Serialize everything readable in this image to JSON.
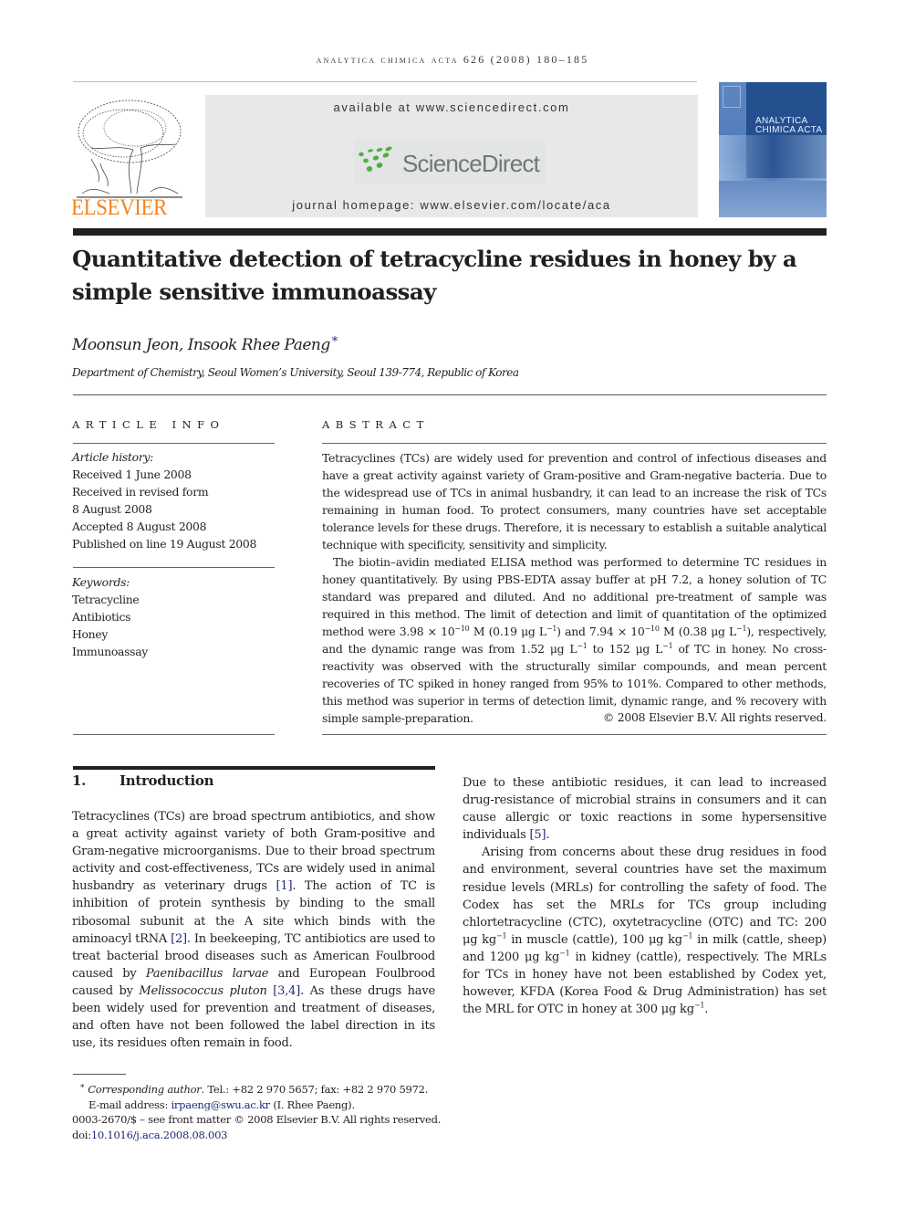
{
  "header": {
    "running_head": "analytica chimica acta 626 (2008) 180–185",
    "available_at": "available at www.sciencedirect.com",
    "sciencedirect_logo": "ScienceDirect",
    "journal_homepage": "journal homepage: www.elsevier.com/locate/aca",
    "publisher_logo": "ELSEVIER",
    "cover": {
      "line1": "ANALYTICA",
      "line2": "CHIMICA ACTA"
    },
    "colors": {
      "elsevier_orange": "#f5841f",
      "sciencedirect_green": "#4fae3a",
      "link_blue": "#1d2a7a",
      "cover_blue": "#1f4a8a"
    }
  },
  "article": {
    "title": "Quantitative detection of tetracycline residues in honey by a simple sensitive immunoassay",
    "authors": "Moonsun Jeon, Insook Rhee Paeng",
    "corresponding_marker": "*",
    "affiliation": "Department of Chemistry, Seoul Women’s University, Seoul 139-774, Republic of Korea"
  },
  "article_info": {
    "heading": "ARTICLE INFO",
    "history_label": "Article history:",
    "history": [
      "Received 1 June 2008",
      "Received in revised form",
      "8 August 2008",
      "Accepted 8 August 2008",
      "Published on line 19 August 2008"
    ],
    "keywords_label": "Keywords:",
    "keywords": [
      "Tetracycline",
      "Antibiotics",
      "Honey",
      "Immunoassay"
    ]
  },
  "abstract": {
    "heading": "ABSTRACT",
    "p1": "Tetracyclines (TCs) are widely used for prevention and control of infectious diseases and have a great activity against variety of Gram-positive and Gram-negative bacteria. Due to the widespread use of TCs in animal husbandry, it can lead to an increase the risk of TCs remaining in human food. To protect consumers, many countries have set acceptable tolerance levels for these drugs. Therefore, it is necessary to establish a suitable analytical technique with specificity, sensitivity and simplicity.",
    "p2_a": "The biotin–avidin mediated ELISA method was performed to determine TC residues in honey quantitatively. By using PBS-EDTA assay buffer at pH 7.2, a honey solution of TC standard was prepared and diluted. And no additional pre-treatment of sample was required in this method. The limit of detection and limit of quantitation of the optimized method were 3.98 × 10",
    "p2_exp1": "−10",
    "p2_b": " M (0.19 μg L",
    "p2_exp2": "−1",
    "p2_c": ") and 7.94 × 10",
    "p2_exp3": "−10",
    "p2_d": " M (0.38 μg L",
    "p2_exp4": "−1",
    "p2_e": "), respectively, and the dynamic range was from 1.52 μg L",
    "p2_exp5": "−1",
    "p2_f": " to 152 μg L",
    "p2_exp6": "−1",
    "p2_g": " of TC in honey. No cross-reactivity was observed with the structurally similar compounds, and mean percent recoveries of TC spiked in honey ranged from 95% to 101%. Compared to other methods, this method was superior in terms of detection limit, dynamic range, and % recovery with simple sample-preparation.",
    "copyright": "© 2008 Elsevier B.V. All rights reserved."
  },
  "introduction": {
    "number": "1.",
    "heading": "Introduction",
    "left": {
      "t1": "Tetracyclines (TCs) are broad spectrum antibiotics, and show a great activity against variety of both Gram-positive and Gram-negative microorganisms. Due to their broad spectrum activity and cost-effectiveness, TCs are widely used in animal husbandry as veterinary drugs ",
      "r1": "[1]",
      "t2": ". The action of TC is inhibition of protein synthesis by binding to the small ribosomal subunit at the A site which binds with the aminoacyl tRNA ",
      "r2": "[2]",
      "t3": ". In beekeeping, TC antibiotics are used to treat bacterial brood diseases such as American Foulbrood caused by ",
      "i1": "Paenibacillus larvae",
      "t4": " and European Foulbrood caused by ",
      "i2": "Melissococcus pluton",
      "t5": " ",
      "r3": "[3,4]",
      "t6": ". As these drugs have been widely used for prevention and treatment of diseases, and often have not been followed the label direction in its use, its residues often remain in food."
    },
    "right": {
      "p1_text": "Due to these antibiotic residues, it can lead to increased drug-resistance of microbial strains in consumers and it can cause allergic or toxic reactions in some hypersensitive individuals ",
      "p1_ref": "[5]",
      "p1_end": ".",
      "p2_a": "Arising from concerns about these drug residues in food and environment, several countries have set the maximum residue levels (MRLs) for controlling the safety of food. The Codex has set the MRLs for TCs group including chlortetracycline (CTC), oxytetracycline (OTC) and TC: 200 μg kg",
      "e1": "−1",
      "p2_b": " in muscle (cattle), 100 μg kg",
      "e2": "−1",
      "p2_c": " in milk (cattle, sheep) and 1200 μg kg",
      "e3": "−1",
      "p2_d": " in kidney (cattle), respectively. The MRLs for TCs in honey have not been established by Codex yet, however, KFDA (Korea Food & Drug Administration) has set the MRL for OTC in honey at 300 μg kg",
      "e4": "−1",
      "p2_e": "."
    }
  },
  "footnotes": {
    "star": "*",
    "corr_label": "Corresponding author",
    "corr_text": ". Tel.: +82 2 970 5657; fax: +82 2 970 5972.",
    "email_label": "E-mail address: ",
    "email": "irpaeng@swu.ac.kr",
    "email_name": " (I. Rhee Paeng).",
    "front_matter": "0003-2670/$ – see front matter © 2008 Elsevier B.V. All rights reserved.",
    "doi_label": "doi:",
    "doi": "10.1016/j.aca.2008.08.003"
  }
}
